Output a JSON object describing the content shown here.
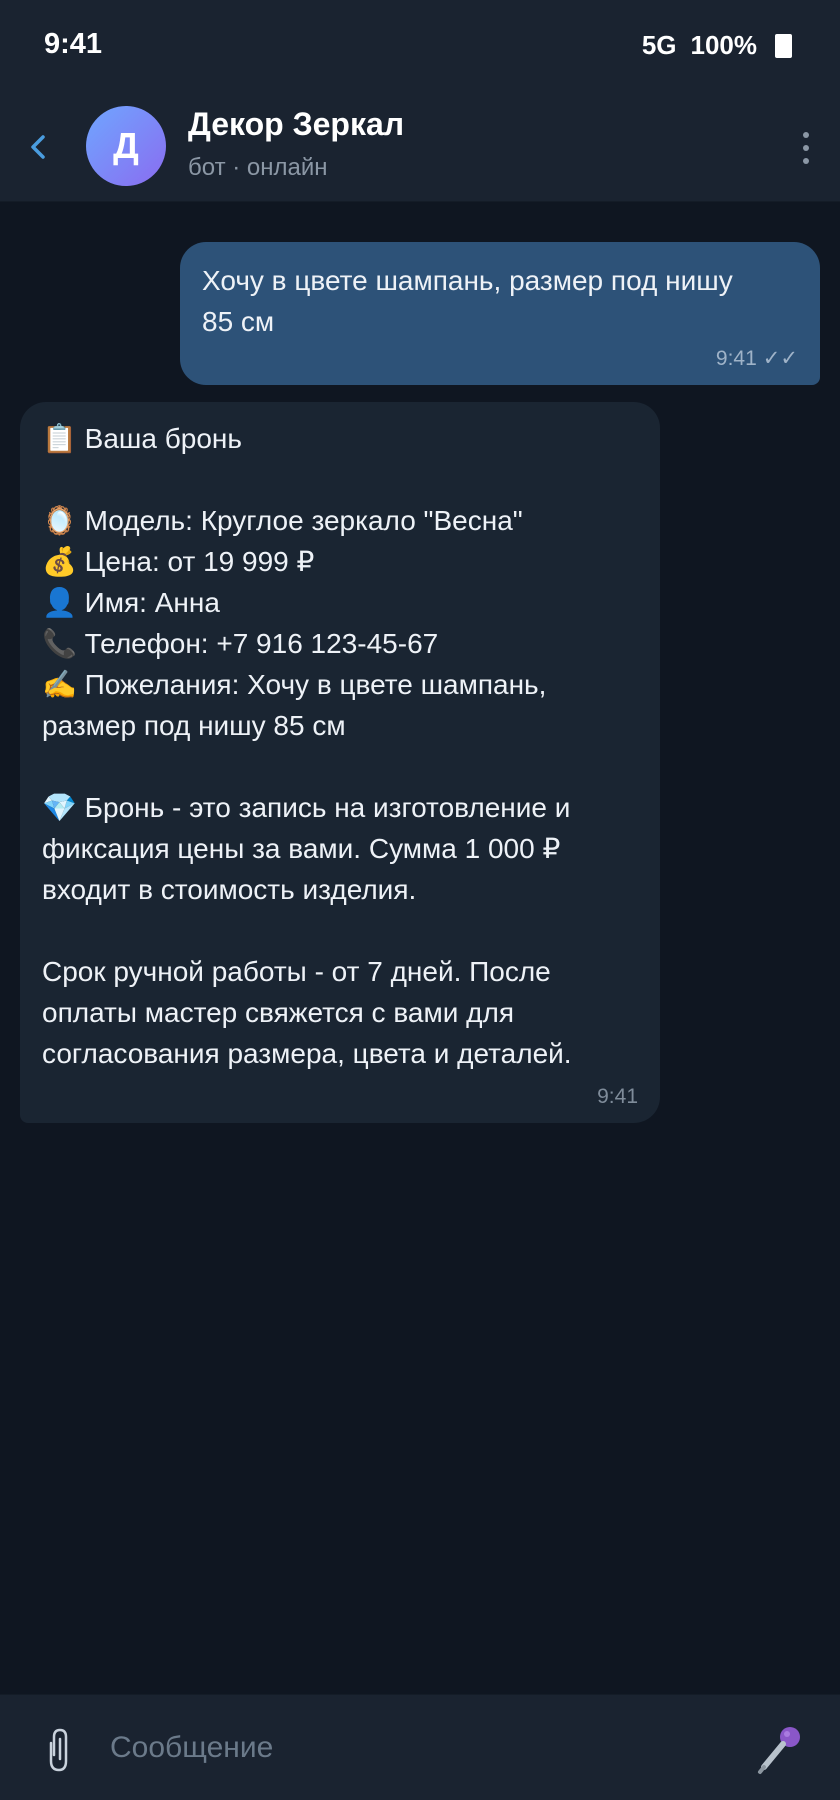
{
  "status_bar": {
    "time": "9:41",
    "network": "5G",
    "battery": "100%"
  },
  "header": {
    "avatar_letter": "Д",
    "title": "Декор Зеркал",
    "subtitle": "бот · онлайн"
  },
  "messages": [
    {
      "direction": "outgoing",
      "text": "Хочу в цвете шампань, размер под нишу\n85 см",
      "time": "9:41",
      "status": "✓✓"
    },
    {
      "direction": "incoming",
      "text": "📋 Ваша бронь\n\n🪞 Модель: Круглое зеркало \"Весна\"\n💰 Цена: от 19 999 ₽\n👤 Имя: Анна\n📞 Телефон: +7 916 123-45-67\n✍️ Пожелания: Хочу в цвете шампань,\nразмер под нишу 85 см\n\n💎 Бронь - это запись на изготовление и\nфиксация цены за вами. Сумма 1 000 ₽\nвходит в стоимость изделия.\n\nСрок ручной работы - от 7 дней. После\nоплаты мастер свяжется с вами для\nсогласования размера, цвета и деталей.",
      "time": "9:41"
    }
  ],
  "composer": {
    "placeholder": "Сообщение",
    "value": ""
  },
  "icons": {
    "back": "chevron-left-icon",
    "menu": "kebab-menu-icon",
    "attach": "paperclip-icon",
    "mic": "microphone-icon",
    "read_receipt": "double-check-icon"
  },
  "colors": {
    "background": "#0f1621",
    "header": "#1a2330",
    "outgoing_bubble": "#2d5278",
    "incoming_bubble": "#1a2532",
    "accent": "#4a9de0"
  }
}
